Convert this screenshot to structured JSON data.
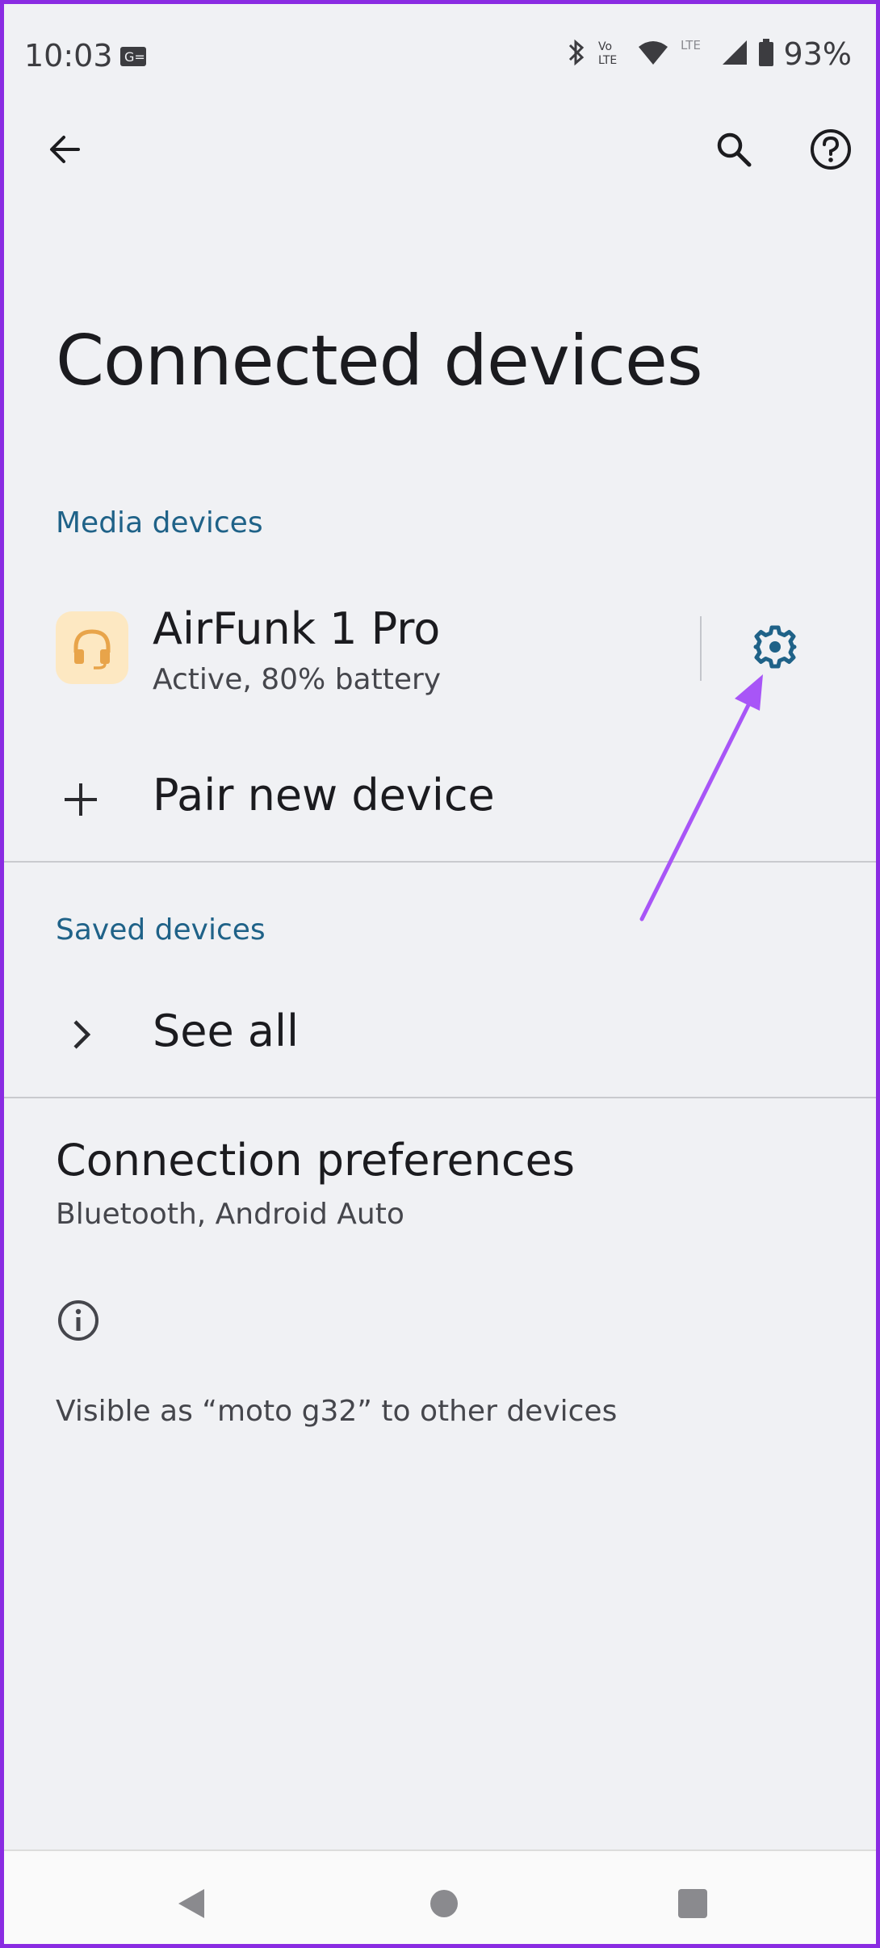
{
  "status_bar": {
    "time": "10:03",
    "battery": "93%",
    "icons": [
      "sim-card-icon",
      "bluetooth-icon",
      "volte-icon",
      "wifi-icon",
      "lte-icon",
      "signal-icon",
      "battery-icon"
    ]
  },
  "app_bar": {
    "back_icon": "arrow-back-icon",
    "search_icon": "search-icon",
    "help_icon": "help-icon"
  },
  "title": "Connected devices",
  "media_section": {
    "header": "Media devices",
    "device": {
      "name": "AirFunk 1 Pro",
      "status": "Active, 80% battery",
      "icon": "headset-icon",
      "settings_icon": "gear-icon"
    },
    "pair_label": "Pair new device"
  },
  "saved_section": {
    "header": "Saved devices",
    "see_all_label": "See all"
  },
  "connection_preferences": {
    "title": "Connection preferences",
    "subtitle": "Bluetooth, Android Auto"
  },
  "footer_info": {
    "icon": "info-icon",
    "text": "Visible as “moto g32” to other devices"
  },
  "nav_bar": {
    "back": "nav-back-icon",
    "home": "nav-home-icon",
    "recents": "nav-recents-icon"
  },
  "colors": {
    "accent": "#1f6288",
    "annotation": "#a855f7",
    "frame": "#8a2be2",
    "avatar_bg": "#fde8c2",
    "avatar_fg": "#e8a44a"
  }
}
